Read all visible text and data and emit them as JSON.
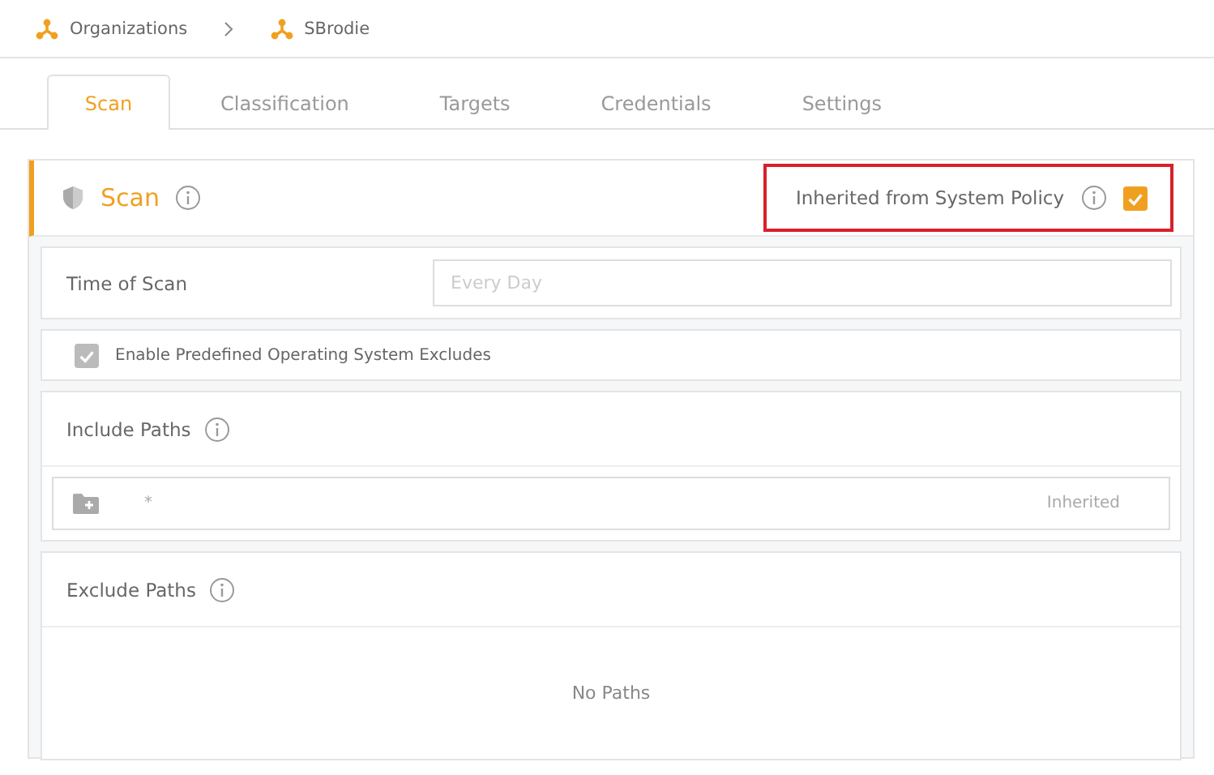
{
  "breadcrumb": [
    {
      "label": "Organizations"
    },
    {
      "label": "SBrodie"
    }
  ],
  "tabs": [
    {
      "label": "Scan",
      "selected": true
    },
    {
      "label": "Classification",
      "selected": false
    },
    {
      "label": "Targets",
      "selected": false
    },
    {
      "label": "Credentials",
      "selected": false
    },
    {
      "label": "Settings",
      "selected": false
    }
  ],
  "section": {
    "title": "Scan",
    "inherit_label": "Inherited from System Policy",
    "inherit_checked": true
  },
  "time_of_scan": {
    "label": "Time of Scan",
    "placeholder": "Every Day"
  },
  "os_excludes": {
    "label": "Enable Predefined Operating System Excludes",
    "checked": true,
    "disabled": true
  },
  "include_paths": {
    "title": "Include Paths",
    "paths": [
      {
        "path": "*",
        "status": "Inherited"
      }
    ]
  },
  "exclude_paths": {
    "title": "Exclude Paths",
    "empty_text": "No Paths"
  }
}
